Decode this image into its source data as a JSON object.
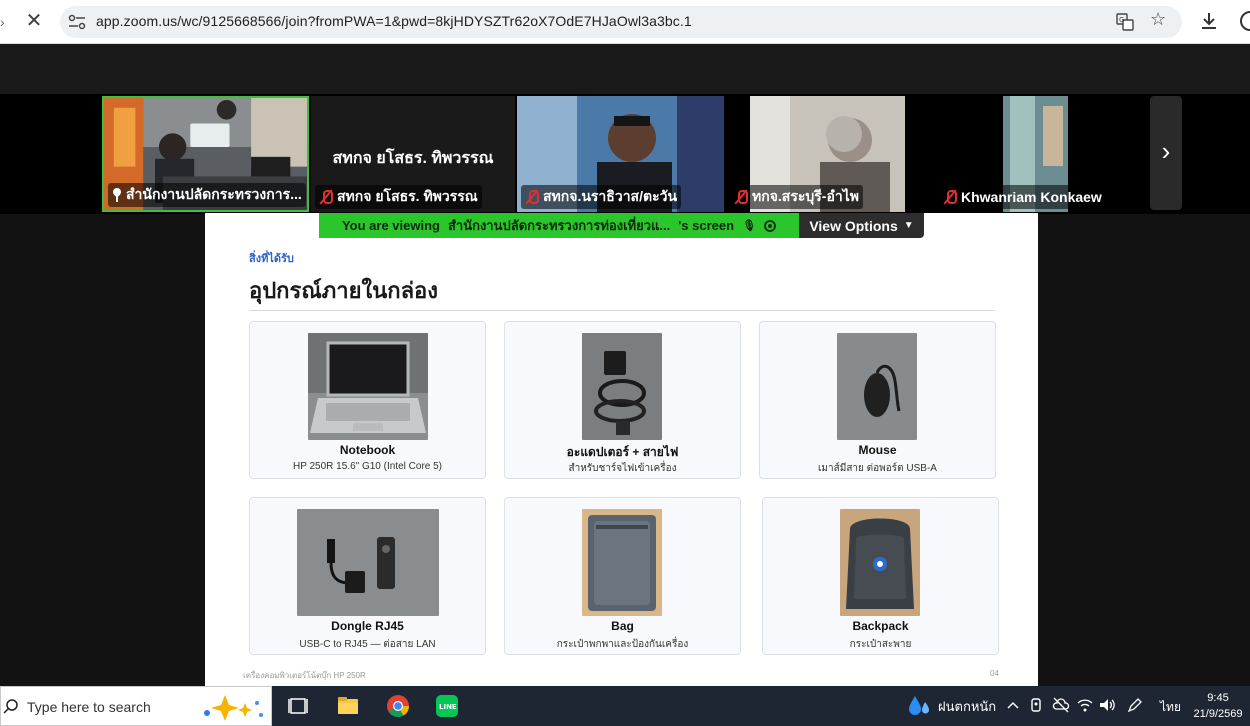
{
  "browser": {
    "url": "app.zoom.us/wc/9125668566/join?fromPWA=1&pwd=8kjHDYSZTr62oX7OdE7HJaOwl3a3bc.1"
  },
  "zoom": {
    "participants": [
      {
        "name": "สำนักงานปลัดกระทรวงการ...",
        "muted": false,
        "pinned": true,
        "active": true
      },
      {
        "name": "สทกจ ยโสธร. ทิพวรรณ",
        "muted": true,
        "center_label": "สทกจ ยโสธร. ทิพวรรณ"
      },
      {
        "name": "สทกจ.นราธิวาส/ตะวัน",
        "muted": true
      },
      {
        "name": "ทกจ.สระบุรี-อำไพ",
        "muted": true
      },
      {
        "name": "Khwanriam Konkaew",
        "muted": true
      }
    ],
    "viewing_banner": {
      "prefix": "You are viewing",
      "owner": "สำนักงานปลัดกระทรวงการท่องเที่ยวแ...",
      "suffix": "'s screen"
    },
    "view_options_label": "View Options"
  },
  "slide": {
    "section_label": "สิ่งที่ได้รับ",
    "title": "อุปกรณ์ภายในกล่อง",
    "items": [
      {
        "title": "Notebook",
        "subtitle": "HP 250R 15.6\" G10 (Intel Core 5)"
      },
      {
        "title": "อะแดปเตอร์ + สายไฟ",
        "subtitle": "สำหรับชาร์จไฟเข้าเครื่อง"
      },
      {
        "title": "Mouse",
        "subtitle": "เมาส์มีสาย ต่อพอร์ต USB-A"
      },
      {
        "title": "Dongle RJ45",
        "subtitle": "USB-C to RJ45 — ต่อสาย LAN"
      },
      {
        "title": "Bag",
        "subtitle": "กระเป๋าพกพาและป้องกันเครื่อง"
      },
      {
        "title": "Backpack",
        "subtitle": "กระเป๋าสะพาย"
      }
    ],
    "footer_left": "เครื่องคอมพิวเตอร์โน้ตบุ๊ก HP 250R",
    "footer_right": "04"
  },
  "taskbar": {
    "search_placeholder": "Type here to search",
    "weather_text": "ฝนตกหนัก",
    "language": "ไทย",
    "time": "9:45",
    "date": "21/9/2569"
  },
  "colors": {
    "active_tile_border": "#3fbf3f",
    "viewing_banner": "#2bc62b",
    "section_label": "#2e64c8",
    "taskbar": "#1f2633"
  }
}
